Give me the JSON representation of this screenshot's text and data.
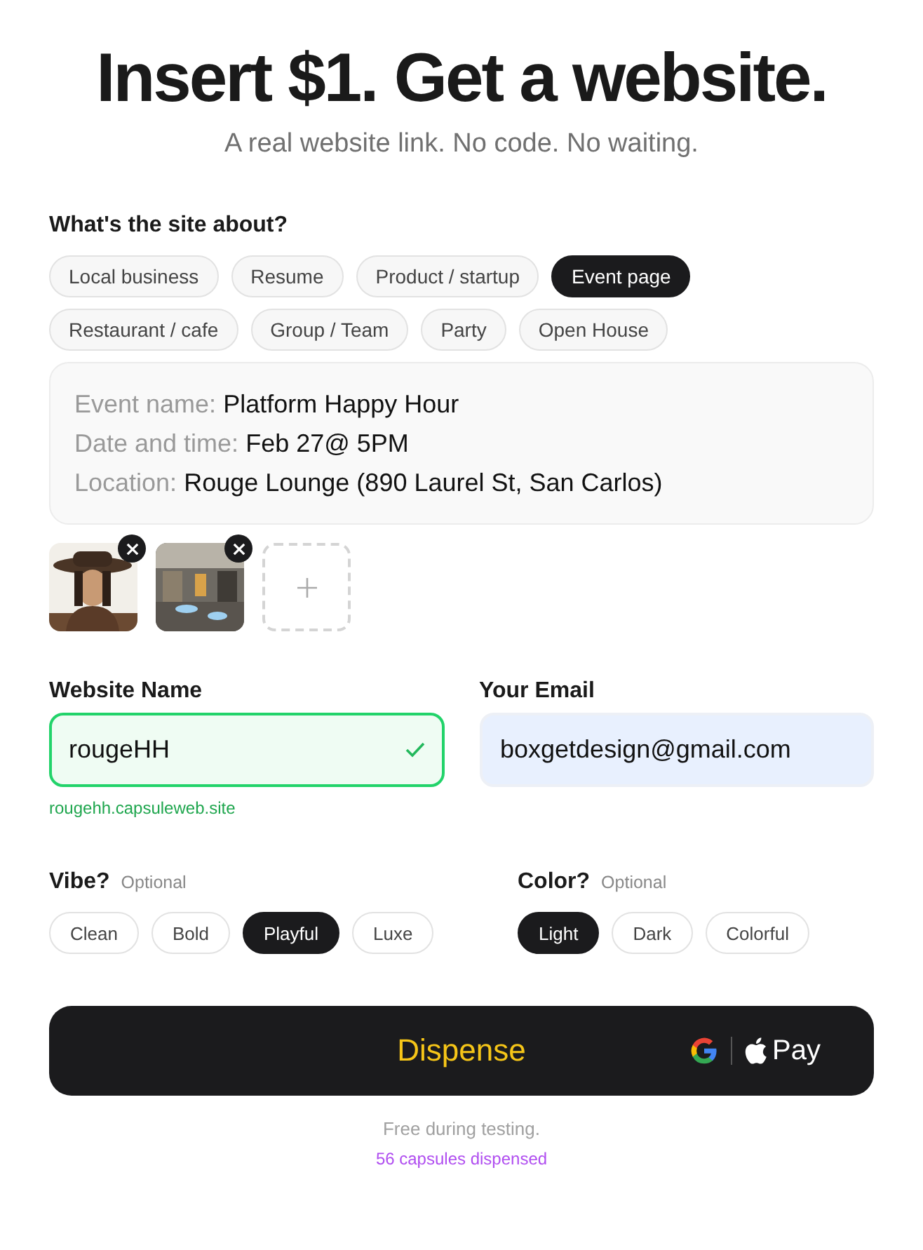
{
  "headline": "Insert $1. Get a website.",
  "subtitle": "A real website link. No code. No waiting.",
  "topic": {
    "label": "What's the site about?",
    "options": [
      {
        "label": "Local business",
        "selected": false
      },
      {
        "label": "Resume",
        "selected": false
      },
      {
        "label": "Product / startup",
        "selected": false
      },
      {
        "label": "Event page",
        "selected": true
      },
      {
        "label": "Restaurant / cafe",
        "selected": false
      },
      {
        "label": "Group / Team",
        "selected": false
      },
      {
        "label": "Party",
        "selected": false
      },
      {
        "label": "Open House",
        "selected": false
      }
    ]
  },
  "details": [
    {
      "label": "Event name:",
      "value": "Platform Happy Hour"
    },
    {
      "label": "Date and time:",
      "value": "Feb 27@ 5PM"
    },
    {
      "label": "Location:",
      "value": "Rouge Lounge (890 Laurel St, San Carlos)"
    }
  ],
  "site_name": {
    "label": "Website Name",
    "value": "rougeHH",
    "valid": true,
    "hint": "rougehh.capsuleweb.site"
  },
  "email": {
    "label": "Your Email",
    "value": "boxgetdesign@gmail.com"
  },
  "vibe": {
    "label": "Vibe?",
    "note": "Optional",
    "options": [
      {
        "label": "Clean",
        "selected": false
      },
      {
        "label": "Bold",
        "selected": false
      },
      {
        "label": "Playful",
        "selected": true
      },
      {
        "label": "Luxe",
        "selected": false
      }
    ]
  },
  "color": {
    "label": "Color?",
    "note": "Optional",
    "options": [
      {
        "label": "Light",
        "selected": true
      },
      {
        "label": "Dark",
        "selected": false
      },
      {
        "label": "Colorful",
        "selected": false
      }
    ]
  },
  "dispense": {
    "label": "Dispense",
    "pay": "Pay"
  },
  "footer": {
    "note": "Free during testing.",
    "count": "56 capsules dispensed"
  }
}
